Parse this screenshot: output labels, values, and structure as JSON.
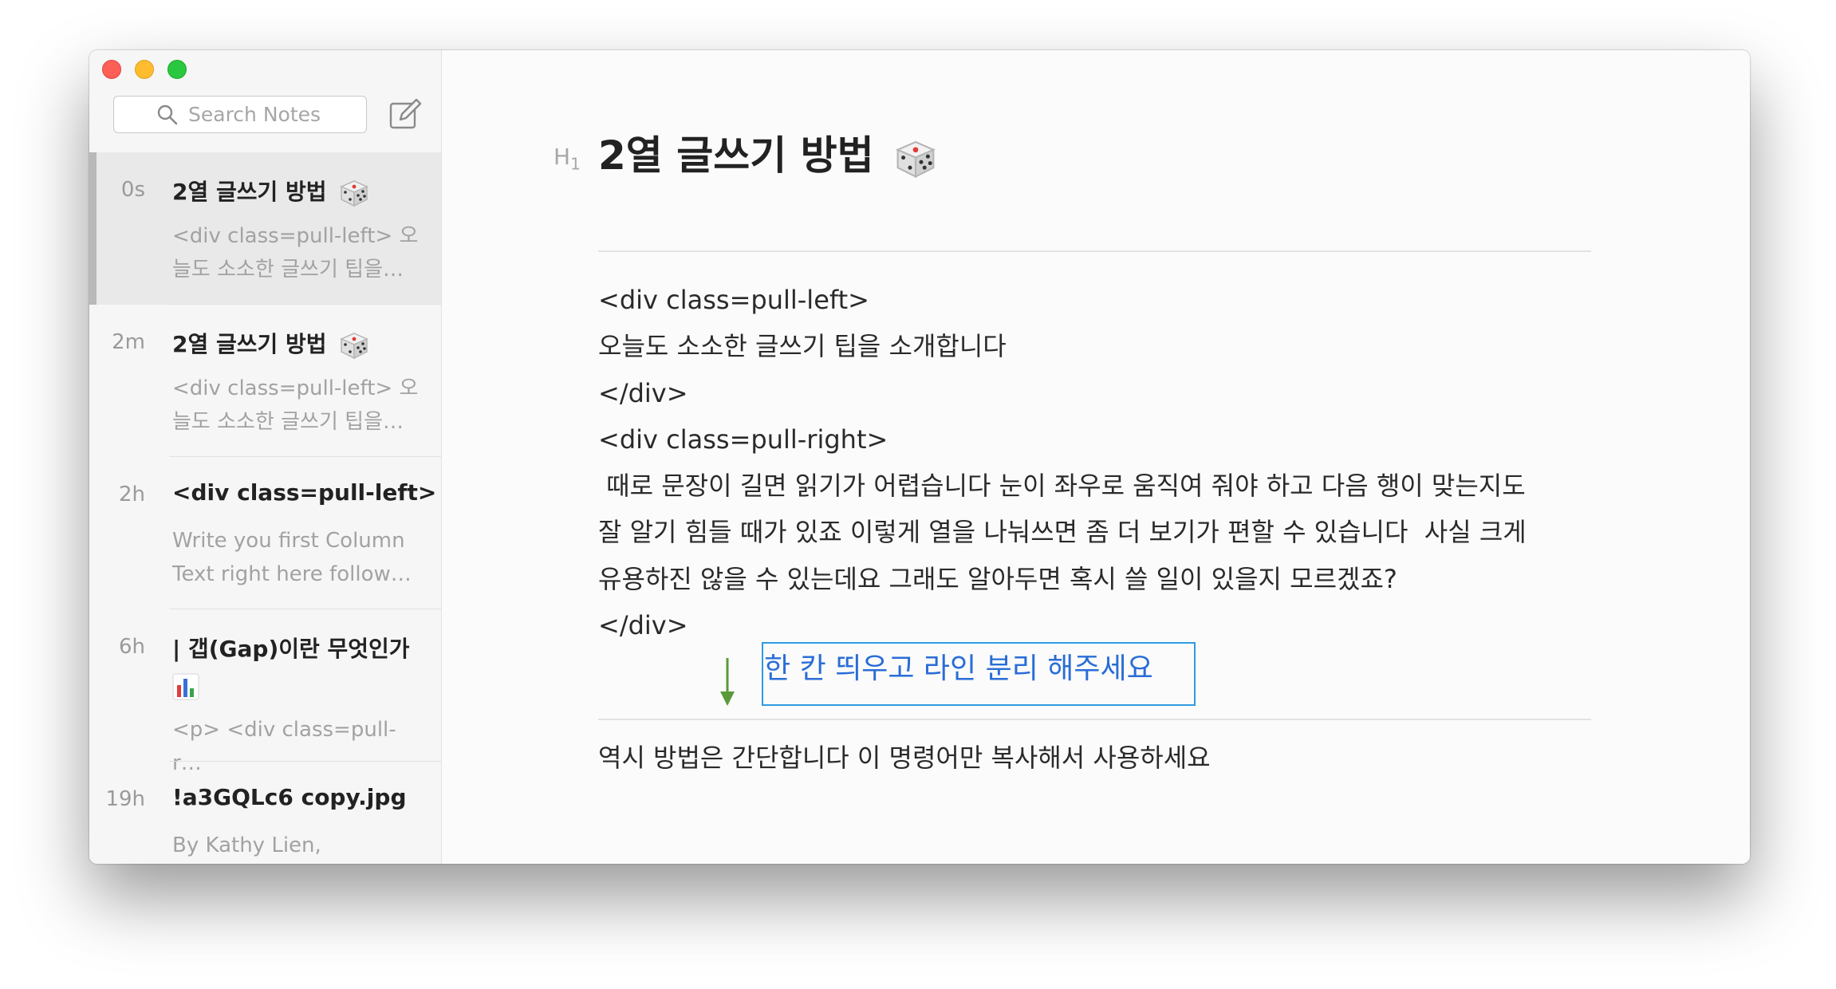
{
  "search": {
    "placeholder": "Search Notes"
  },
  "notes": [
    {
      "time": "0s",
      "title": "2열 글쓰기 방법",
      "icon": "die-icon",
      "preview": "<div class=pull-left> 오늘도 소소한 글쓰기 팁을…",
      "selected": true
    },
    {
      "time": "2m",
      "title": "2열 글쓰기 방법",
      "icon": "die-icon",
      "preview": "<div class=pull-left> 오늘도 소소한 글쓰기 팁을…",
      "selected": false
    },
    {
      "time": "2h",
      "title": "<div class=pull-left>",
      "preview": "Write you first Column Text right here follow…",
      "selected": false
    },
    {
      "time": "6h",
      "title": "| 갭(Gap)이란 무엇인가",
      "icon": "bar-chart-icon",
      "preview": "<p> <div class=pull-r…",
      "selected": false
    },
    {
      "time": "19h",
      "title": "!a3GQLc6 copy.jpg",
      "preview": "By Kathy Lien,",
      "selected": false
    }
  ],
  "editor": {
    "heading_marker": "H",
    "heading_marker_level": "1",
    "title": "2열 글쓰기 방법",
    "title_icon": "die-icon",
    "body_lines": [
      "<div class=pull-left>",
      "오늘도 소소한 글쓰기 팁을 소개합니다",
      "</div>",
      "<div class=pull-right>",
      " 때로 문장이 길면 읽기가 어렵습니다 눈이 좌우로 움직여 줘야 하고 다음 행이 맞는지도",
      "잘 알기 힘들 때가 있죠 이렇게 열을 나눠쓰면 좀 더 보기가 편할 수 있습니다  사실 크게",
      "유용하진 않을 수 있는데요 그래도 알아두면 혹시 쓸 일이 있을지 모르겠죠?",
      "</div>"
    ],
    "annotation": "한 칸 띄우고 라인 분리 해주세요",
    "footer_text": "역시 방법은 간단합니다 이 명령어만 복사해서 사용하세요"
  },
  "colors": {
    "annotation_blue": "#2a6dd6",
    "annotation_border": "#2e9be0",
    "arrow_green": "#5a9a3a",
    "close": "#fd5f57",
    "minimize": "#febc2e",
    "zoom": "#29c840"
  },
  "icons": {
    "search": "search-icon",
    "compose": "compose-icon",
    "info": "info-icon",
    "share": "share-icon",
    "trash": "trash-icon",
    "pen": "pen-icon",
    "sidebar_toggle": "sidebar-toggle-icon"
  }
}
